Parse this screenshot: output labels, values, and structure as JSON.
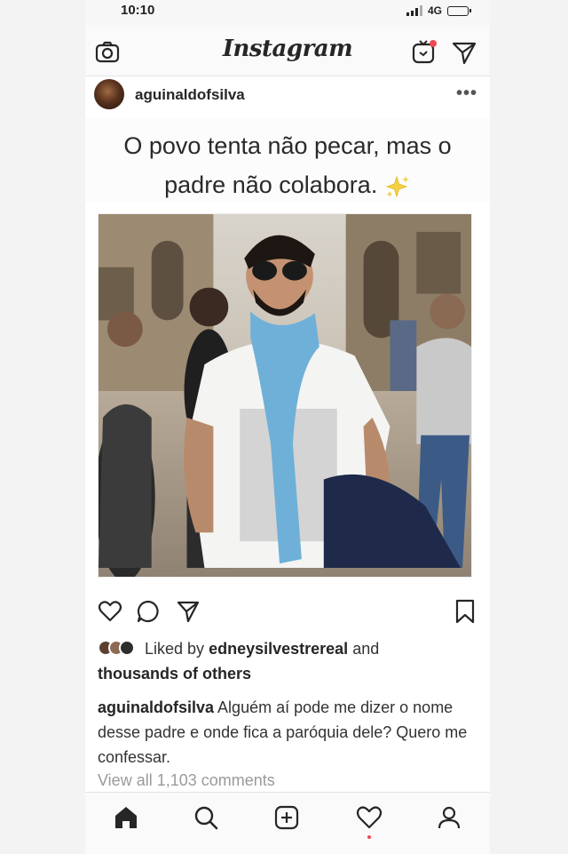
{
  "status_bar": {
    "time": "10:10",
    "network": "4G"
  },
  "header": {
    "logo": "Instagram"
  },
  "post": {
    "username": "aguinaldofsilva",
    "more": "•••",
    "caption_card": {
      "line1": "O povo tenta não pecar, mas o",
      "line2": "padre não colabora."
    },
    "likes": {
      "prefix": "Liked by",
      "user": "edneysilvestrereal",
      "and": "and",
      "others": "thousands of others"
    },
    "caption": {
      "username": "aguinaldofsilva",
      "text": "Alguém aí pode me dizer o nome desse padre e onde fica a paróquia dele? Quero me confessar."
    },
    "view_comments": "View all 1,103 comments"
  },
  "colors": {
    "accent": "#ed4956",
    "text": "#262626",
    "muted": "#9a9a9a"
  },
  "icons": {
    "header": [
      "camera-icon",
      "igtv-icon",
      "direct-icon"
    ],
    "actions": [
      "heart-icon",
      "comment-icon",
      "share-icon",
      "save-icon"
    ],
    "nav": [
      "home-icon",
      "search-icon",
      "add-post-icon",
      "activity-icon",
      "profile-icon"
    ]
  }
}
